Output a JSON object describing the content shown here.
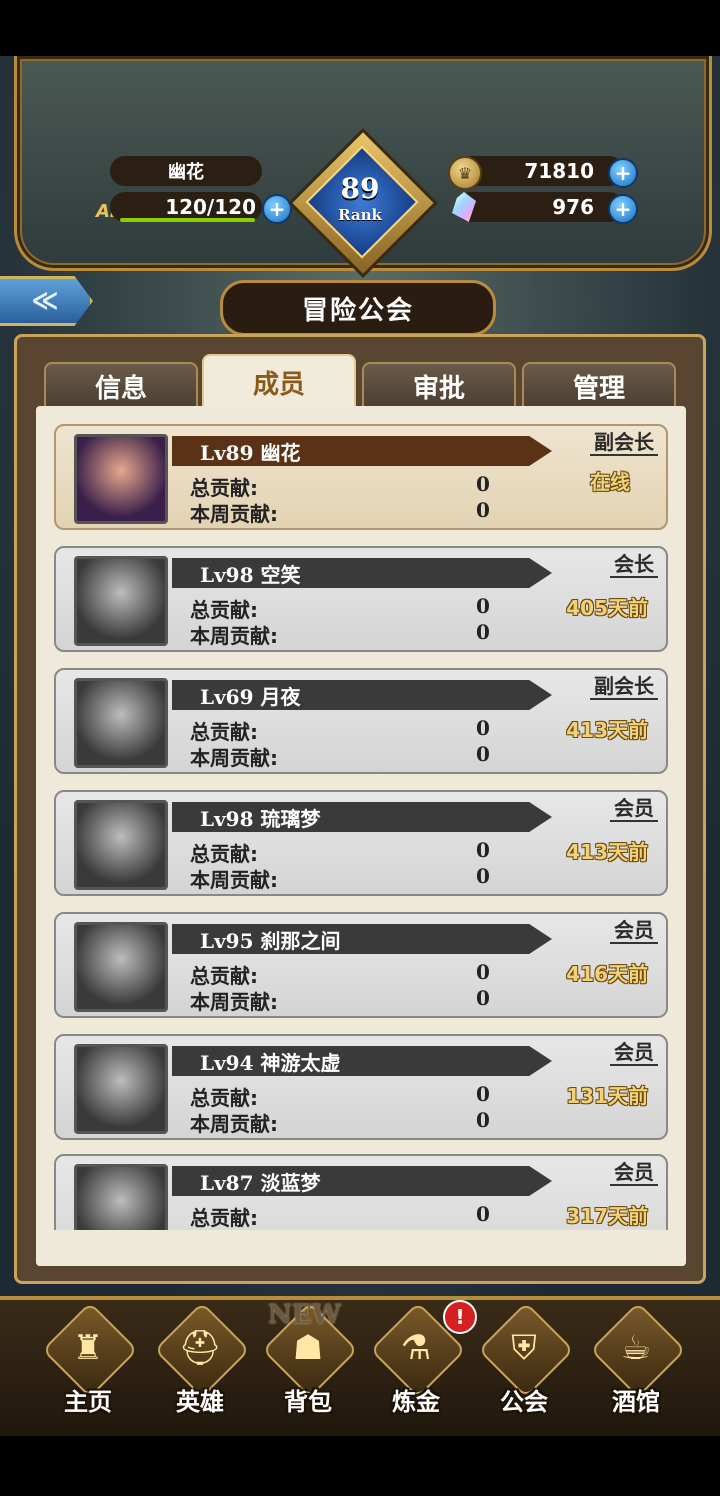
{
  "header": {
    "player_name": "幽花",
    "ap_label": "AP",
    "ap_value": "120/120",
    "rank_number": "89",
    "rank_label": "Rank",
    "gold": "71810",
    "gems": "976",
    "plus_symbol": "+"
  },
  "nav": {
    "back_symbol": "≪"
  },
  "page_title": "冒险公会",
  "tabs": [
    {
      "label": "信息"
    },
    {
      "label": "成员"
    },
    {
      "label": "审批"
    },
    {
      "label": "管理"
    }
  ],
  "active_tab": "成员",
  "stat_labels": {
    "total": "总贡献:",
    "weekly": "本周贡献:"
  },
  "members": [
    {
      "name": "Lv89 幽花",
      "role": "副会长",
      "total": "0",
      "weekly": "0",
      "status": "在线"
    },
    {
      "name": "Lv98 空笑",
      "role": "会长",
      "total": "0",
      "weekly": "0",
      "status": "405天前"
    },
    {
      "name": "Lv69 月夜",
      "role": "副会长",
      "total": "0",
      "weekly": "0",
      "status": "413天前"
    },
    {
      "name": "Lv98 琉璃梦",
      "role": "会员",
      "total": "0",
      "weekly": "0",
      "status": "413天前"
    },
    {
      "name": "Lv95 刹那之间",
      "role": "会员",
      "total": "0",
      "weekly": "0",
      "status": "416天前"
    },
    {
      "name": "Lv94 神游太虚",
      "role": "会员",
      "total": "0",
      "weekly": "0",
      "status": "131天前"
    },
    {
      "name": "Lv87 淡蓝梦",
      "role": "会员",
      "total": "0",
      "weekly": "",
      "status": "317天前"
    }
  ],
  "bottom_nav": [
    {
      "label": "主页",
      "icon": "castle-icon"
    },
    {
      "label": "英雄",
      "icon": "helmet-icon"
    },
    {
      "label": "背包",
      "icon": "backpack-icon"
    },
    {
      "label": "炼金",
      "icon": "potion-icon"
    },
    {
      "label": "公会",
      "icon": "guild-shield-icon"
    },
    {
      "label": "酒馆",
      "icon": "beer-mug-icon"
    }
  ],
  "badges": {
    "new_text": "NEW",
    "alert_text": "!"
  }
}
